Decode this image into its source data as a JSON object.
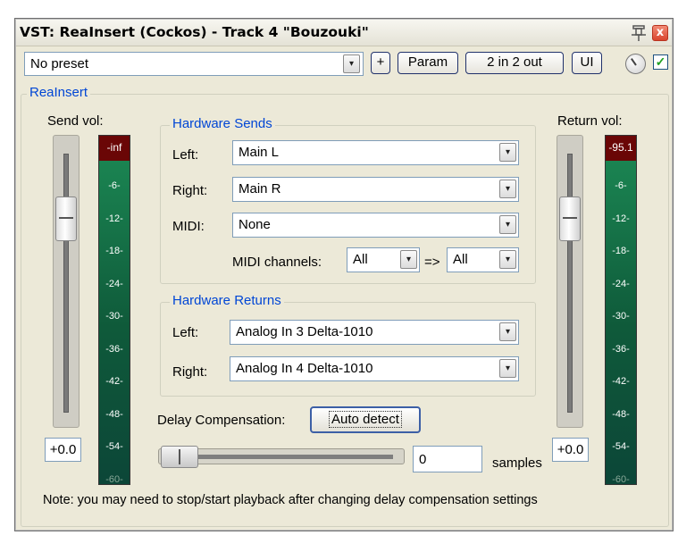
{
  "window": {
    "title": "VST: ReaInsert (Cockos) - Track 4 \"Bouzouki\"",
    "close_label": "x"
  },
  "toolbar": {
    "preset_value": "No preset",
    "dropdown_glyph": "▾",
    "add_label": "+",
    "param_label": "Param",
    "io_label": "2 in 2 out",
    "ui_label": "UI",
    "enabled_checked": true
  },
  "plugin_group_label": "ReaInsert",
  "send": {
    "label": "Send vol:",
    "value": "+0.0",
    "meter_peak": "-inf",
    "fader_level": 0.2
  },
  "return": {
    "label": "Return vol:",
    "value": "+0.0",
    "meter_peak": "-95.1",
    "fader_level": 0.2
  },
  "meter_ticks": [
    "-6-",
    "-12-",
    "-18-",
    "-24-",
    "-30-",
    "-36-",
    "-42-",
    "-48-",
    "-54-",
    "-60-"
  ],
  "hardware_sends": {
    "title": "Hardware Sends",
    "left_label": "Left:",
    "left_value": "Main L",
    "right_label": "Right:",
    "right_value": "Main R",
    "midi_label": "MIDI:",
    "midi_value": "None",
    "midi_channels_label": "MIDI channels:",
    "midi_channel_from": "All",
    "arrow": "=>",
    "midi_channel_to": "All"
  },
  "hardware_returns": {
    "title": "Hardware Returns",
    "left_label": "Left:",
    "left_value": "Analog In 3 Delta-1010",
    "right_label": "Right:",
    "right_value": "Analog In 4 Delta-1010"
  },
  "delay": {
    "label": "Delay Compensation:",
    "auto_detect_label": "Auto detect",
    "samples_value": "0",
    "samples_unit": "samples",
    "slider_level": 0.0
  },
  "note": "Note: you may need to stop/start playback after changing delay compensation settings",
  "colors": {
    "group_title": "#0046d5",
    "meter_green": "#1c8a55",
    "meter_peak_red": "#6a0606",
    "window_bg": "#ece9d8"
  }
}
